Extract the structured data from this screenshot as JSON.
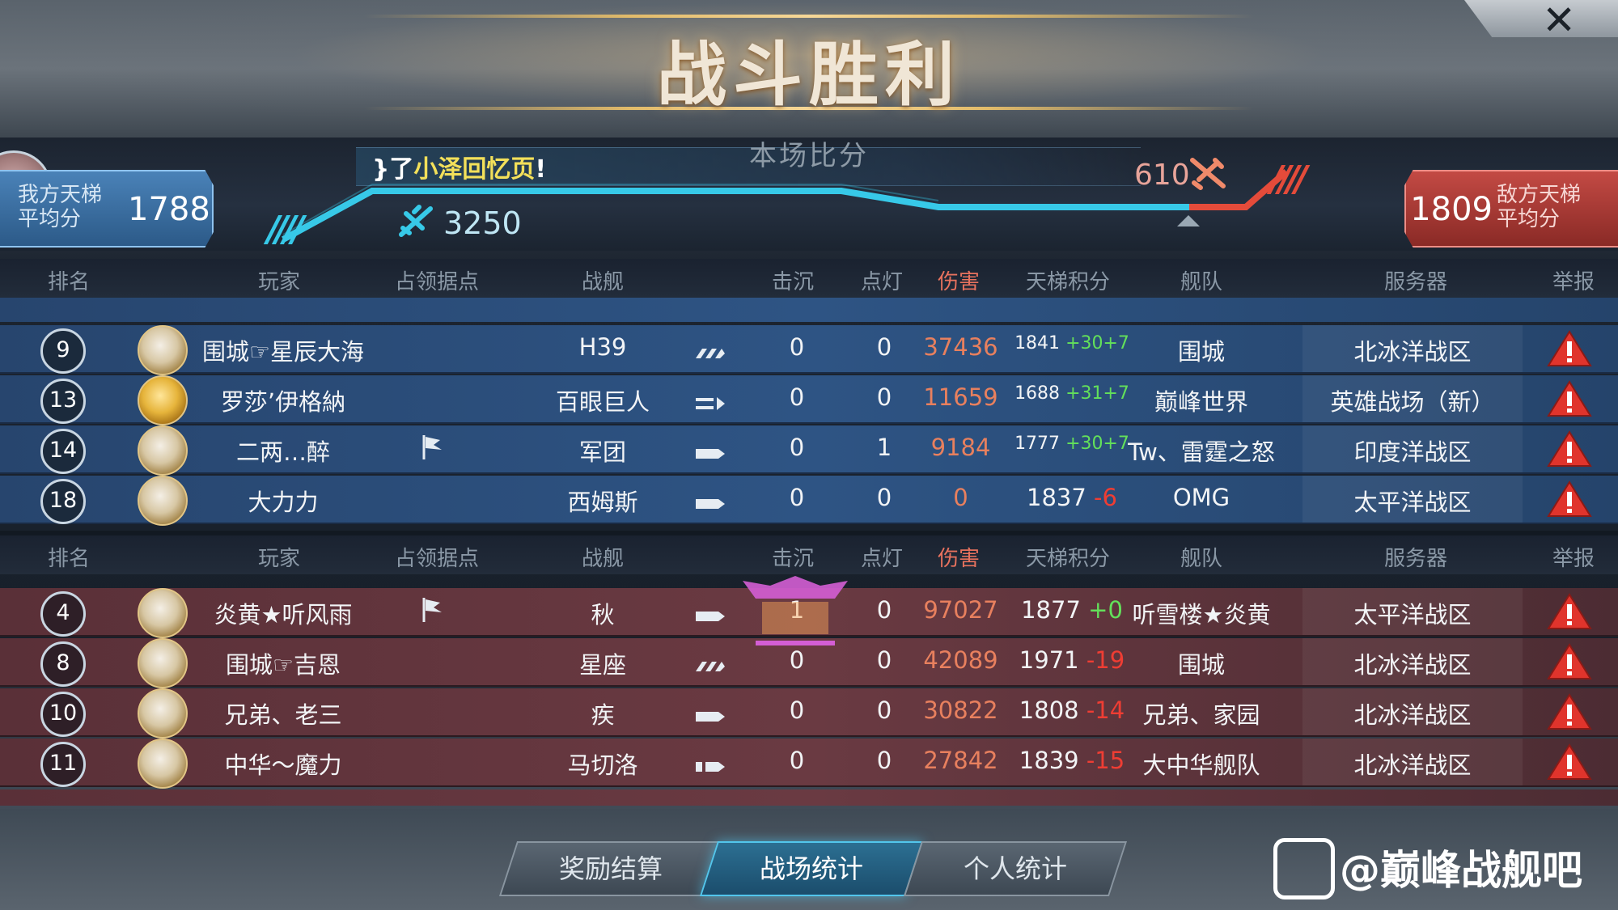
{
  "title": "战斗胜利",
  "score_label": "本场比分",
  "chat": {
    "prefix": "}了",
    "name": "小泽回忆页",
    "suffix": "!"
  },
  "ours": {
    "label_line1": "我方天梯",
    "label_line2": "平均分",
    "avg": "1788",
    "points": "3250"
  },
  "enemy": {
    "label_line1": "敌方天梯",
    "label_line2": "平均分",
    "avg": "1809",
    "points": "610"
  },
  "headers": [
    "排名",
    "玩家",
    "占领据点",
    "战舰",
    "击沉",
    "点灯",
    "伤害",
    "天梯积分",
    "舰队",
    "服务器",
    "举报"
  ],
  "our_rows": [
    {
      "rank": "9",
      "player": "围城☞星辰大海",
      "capture": "",
      "ship": "H39",
      "ship_type": "carrier",
      "kills": "0",
      "spots": "0",
      "damage": "37436",
      "ladder": "1841",
      "delta": "+30+7",
      "fleet": "围城",
      "server": "北冰洋战区",
      "medal": "silver"
    },
    {
      "rank": "13",
      "player": "罗莎’伊格納",
      "capture": "",
      "ship": "百眼巨人",
      "ship_type": "battleship",
      "kills": "0",
      "spots": "0",
      "damage": "11659",
      "ladder": "1688",
      "delta": "+31+7",
      "fleet": "巅峰世界",
      "server": "英雄战场（新）",
      "medal": "gold"
    },
    {
      "rank": "14",
      "player": "二两…醉",
      "capture": "flag",
      "ship": "军团",
      "ship_type": "cruiser",
      "kills": "0",
      "spots": "1",
      "damage": "9184",
      "ladder": "1777",
      "delta": "+30+7",
      "fleet": "Tw、雷霆之怒",
      "server": "印度洋战区",
      "medal": "silver"
    },
    {
      "rank": "18",
      "player": "大力力",
      "capture": "",
      "ship": "西姆斯",
      "ship_type": "cruiser",
      "kills": "0",
      "spots": "0",
      "damage": "0",
      "ladder": "1837",
      "delta": "-6",
      "fleet": "OMG",
      "server": "太平洋战区",
      "medal": "silver"
    }
  ],
  "enemy_rows": [
    {
      "rank": "4",
      "player": "炎黄★听风雨",
      "capture": "flag",
      "ship": "秋",
      "ship_type": "cruiser",
      "kills": "1",
      "spots": "0",
      "damage": "97027",
      "ladder": "1877",
      "delta": "+0",
      "fleet": "听雪楼★炎黄",
      "server": "太平洋战区",
      "medal": "silver"
    },
    {
      "rank": "8",
      "player": "围城☞吉恩",
      "capture": "",
      "ship": "星座",
      "ship_type": "carrier",
      "kills": "0",
      "spots": "0",
      "damage": "42089",
      "ladder": "1971",
      "delta": "-19",
      "fleet": "围城",
      "server": "北冰洋战区",
      "medal": "silver"
    },
    {
      "rank": "10",
      "player": "兄弟、老三",
      "capture": "",
      "ship": "疾",
      "ship_type": "cruiser",
      "kills": "0",
      "spots": "0",
      "damage": "30822",
      "ladder": "1808",
      "delta": "-14",
      "fleet": "兄弟、家园",
      "server": "北冰洋战区",
      "medal": "silver"
    },
    {
      "rank": "11",
      "player": "中华～魔力",
      "capture": "",
      "ship": "马切洛",
      "ship_type": "destroyer",
      "kills": "0",
      "spots": "0",
      "damage": "27842",
      "ladder": "1839",
      "delta": "-15",
      "fleet": "大中华舰队",
      "server": "北冰洋战区",
      "medal": "silver"
    }
  ],
  "tabs": [
    "奖励结算",
    "战场统计",
    "个人统计"
  ],
  "active_tab": 1,
  "watermark": "@巅峰战舰吧",
  "colors": {
    "our_team": "#2e5484",
    "enemy_team": "#6a3a42",
    "accent": "#37c9e8",
    "enemy_accent": "#e44b3a",
    "gain": "#63e05a",
    "loss": "#ef3d33"
  }
}
